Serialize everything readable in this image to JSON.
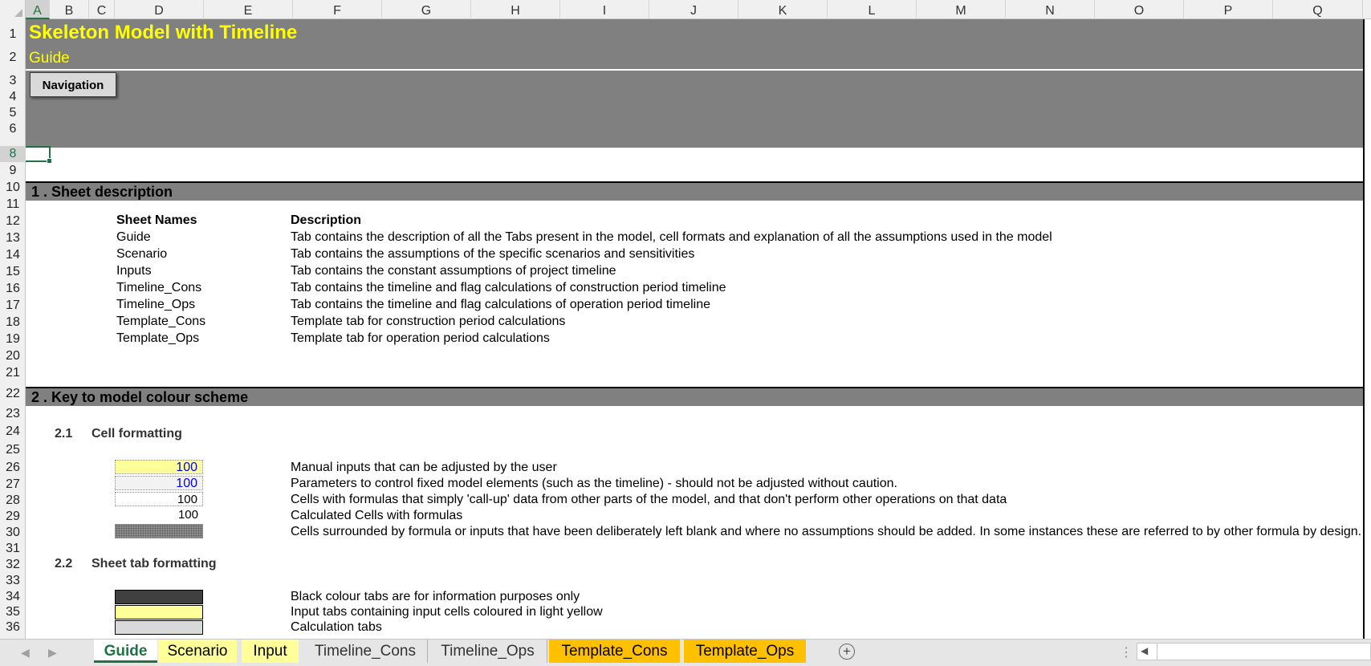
{
  "columns": [
    "A",
    "B",
    "C",
    "D",
    "E",
    "F",
    "G",
    "H",
    "I",
    "J",
    "K",
    "L",
    "M",
    "N",
    "O",
    "P",
    "Q"
  ],
  "rows": [
    "1",
    "2",
    "3",
    "4",
    "5",
    "6",
    "8",
    "9",
    "10",
    "11",
    "12",
    "13",
    "14",
    "15",
    "16",
    "17",
    "18",
    "19",
    "20",
    "21",
    "22",
    "23",
    "24",
    "25",
    "26",
    "27",
    "28",
    "29",
    "30",
    "31",
    "32",
    "33",
    "34",
    "35",
    "36"
  ],
  "header": {
    "title": "Skeleton Model with Timeline",
    "subtitle": "Guide",
    "nav_button": "Navigation"
  },
  "section1": {
    "heading": "1 . Sheet description",
    "col_sheet": "Sheet Names",
    "col_desc": "Description",
    "items": [
      {
        "name": "Guide",
        "desc": "Tab contains the description of all the Tabs present in the model, cell formats and explanation of all the assumptions used in the model"
      },
      {
        "name": "Scenario",
        "desc": "Tab contains the assumptions of the specific scenarios and sensitivities"
      },
      {
        "name": "Inputs",
        "desc": "Tab contains the constant assumptions of project timeline"
      },
      {
        "name": "Timeline_Cons",
        "desc": "Tab contains the timeline and flag calculations of construction period timeline"
      },
      {
        "name": "Timeline_Ops",
        "desc": "Tab contains the timeline and flag calculations of operation period timeline"
      },
      {
        "name": "Template_Cons",
        "desc": "Template tab for construction period calculations"
      },
      {
        "name": "Template_Ops",
        "desc": "Template tab for operation period calculations"
      }
    ]
  },
  "section2": {
    "heading": "2 . Key to model colour scheme",
    "sub1_num": "2.1",
    "sub1_label": "Cell formatting",
    "cells": [
      {
        "value": "100",
        "desc": "Manual inputs that can be adjusted by the user"
      },
      {
        "value": "100",
        "desc": "Parameters to control fixed model elements (such as the timeline) - should not be adjusted without caution."
      },
      {
        "value": "100",
        "desc": "Cells with formulas that simply 'call-up' data from other parts of the model, and that don't perform other operations on that data"
      },
      {
        "value": "100",
        "desc": "Calculated Cells with formulas"
      },
      {
        "value": "",
        "desc": "Cells surrounded by formula or inputs that have been deliberately left blank and where no assumptions should be added. In some instances these are referred to by other formula by design."
      }
    ],
    "sub2_num": "2.2",
    "sub2_label": "Sheet tab formatting",
    "tabs_key": [
      {
        "desc": "Black colour tabs are for information purposes only"
      },
      {
        "desc": "Input tabs containing input cells coloured in light yellow"
      },
      {
        "desc": "Calculation tabs"
      }
    ]
  },
  "sheet_tabs": [
    "Guide",
    "Scenario",
    "Input",
    "Timeline_Cons",
    "Timeline_Ops",
    "Template_Cons",
    "Template_Ops"
  ],
  "colors": {
    "band": "#808080",
    "title": "#ffff00",
    "input_cell": "#ffff99",
    "input_font": "#0000ff",
    "tab_yellow": "#ffff99",
    "tab_orange": "#ffc000",
    "excel_green": "#217346"
  }
}
